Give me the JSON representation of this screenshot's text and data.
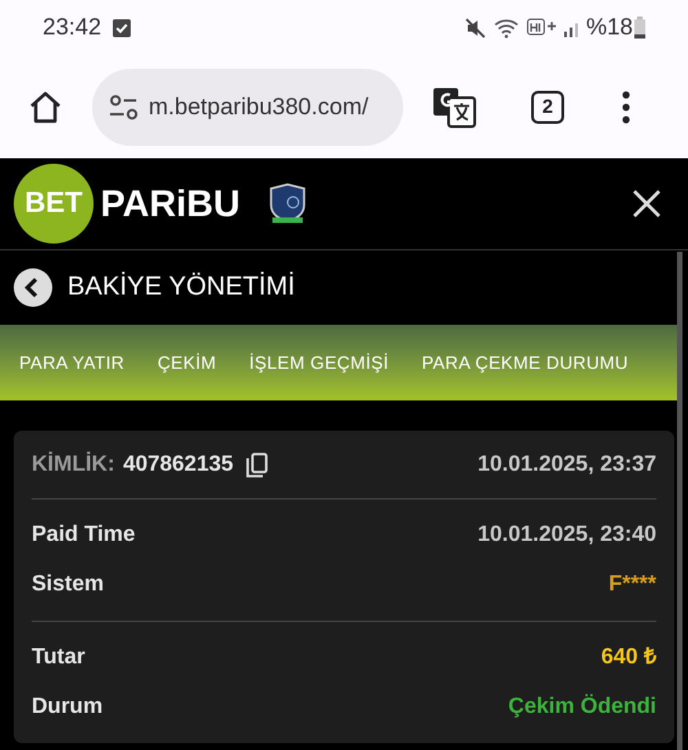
{
  "status_bar": {
    "time": "23:42",
    "battery": "%18"
  },
  "browser": {
    "url": "m.betparibu380.com/",
    "tab_count": "2"
  },
  "header": {
    "logo_circle": "BET",
    "logo_text": "PARiBU"
  },
  "page_title": "BAKİYE YÖNETİMİ",
  "tabs": [
    {
      "label": "PARA YATIR"
    },
    {
      "label": "ÇEKİM"
    },
    {
      "label": "İŞLEM GEÇMİŞİ"
    },
    {
      "label": "PARA ÇEKME DURUMU"
    }
  ],
  "card": {
    "id_label": "KİMLİK:",
    "id_value": "407862135",
    "created": "10.01.2025, 23:37",
    "groups": [
      [
        {
          "label": "Paid Time",
          "value": "10.01.2025, 23:40",
          "color": "#c8c8c8"
        },
        {
          "label": "Sistem",
          "value": "F****",
          "color": "#d69e1c"
        }
      ],
      [
        {
          "label": "Tutar",
          "value": "640 ₺",
          "color": "#f5c518"
        },
        {
          "label": "Durum",
          "value": "Çekim Ödendi",
          "color": "#3cb43c"
        }
      ]
    ]
  }
}
